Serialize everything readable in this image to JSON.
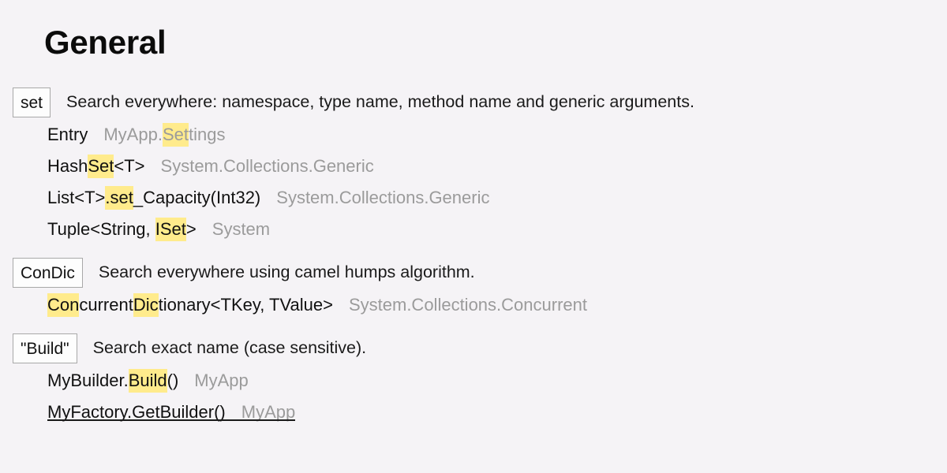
{
  "page": {
    "title": "General",
    "background_color": "#f5f3f6",
    "highlight_color": "#ffeb8c",
    "muted_text_color": "#9b9b9b",
    "text_color": "#111111"
  },
  "sections": [
    {
      "key": "set",
      "description": "Search everywhere: namespace, type name, method name and generic arguments.",
      "results": [
        {
          "name_parts": [
            {
              "text": "Entry",
              "highlighted": false
            }
          ],
          "location_parts": [
            {
              "text": "MyApp.",
              "highlighted": false
            },
            {
              "text": "Set",
              "highlighted": true
            },
            {
              "text": "tings",
              "highlighted": false
            }
          ],
          "struck": false
        },
        {
          "name_parts": [
            {
              "text": "Hash",
              "highlighted": false
            },
            {
              "text": "Set",
              "highlighted": true
            },
            {
              "text": "<T>",
              "highlighted": false
            }
          ],
          "location_parts": [
            {
              "text": "System.Collections.Generic",
              "highlighted": false
            }
          ],
          "struck": false
        },
        {
          "name_parts": [
            {
              "text": "List<T>",
              "highlighted": false
            },
            {
              "text": ".set",
              "highlighted": true
            },
            {
              "text": "_Capacity(Int32)",
              "highlighted": false
            }
          ],
          "location_parts": [
            {
              "text": "System.Collections.Generic",
              "highlighted": false
            }
          ],
          "struck": false
        },
        {
          "name_parts": [
            {
              "text": "Tuple<String, ",
              "highlighted": false
            },
            {
              "text": "ISet",
              "highlighted": true
            },
            {
              "text": ">",
              "highlighted": false
            }
          ],
          "location_parts": [
            {
              "text": "System",
              "highlighted": false
            }
          ],
          "struck": false
        }
      ]
    },
    {
      "key": "ConDic",
      "description": "Search everywhere using camel humps algorithm.",
      "results": [
        {
          "name_parts": [
            {
              "text": "Con",
              "highlighted": true
            },
            {
              "text": "current",
              "highlighted": false
            },
            {
              "text": "Dic",
              "highlighted": true
            },
            {
              "text": "tionary<TKey, TValue>",
              "highlighted": false
            }
          ],
          "location_parts": [
            {
              "text": "System.Collections.Concurrent",
              "highlighted": false
            }
          ],
          "struck": false
        }
      ]
    },
    {
      "key": "\"Build\"",
      "description": "Search exact name (case sensitive).",
      "results": [
        {
          "name_parts": [
            {
              "text": "MyBuilder.",
              "highlighted": false
            },
            {
              "text": "Build",
              "highlighted": true
            },
            {
              "text": "()",
              "highlighted": false
            }
          ],
          "location_parts": [
            {
              "text": "MyApp",
              "highlighted": false
            }
          ],
          "struck": false
        },
        {
          "name_parts": [
            {
              "text": "MyFactory.GetBuilder()",
              "highlighted": false
            }
          ],
          "location_parts": [
            {
              "text": "MyApp",
              "highlighted": false
            }
          ],
          "struck": true
        }
      ]
    }
  ]
}
